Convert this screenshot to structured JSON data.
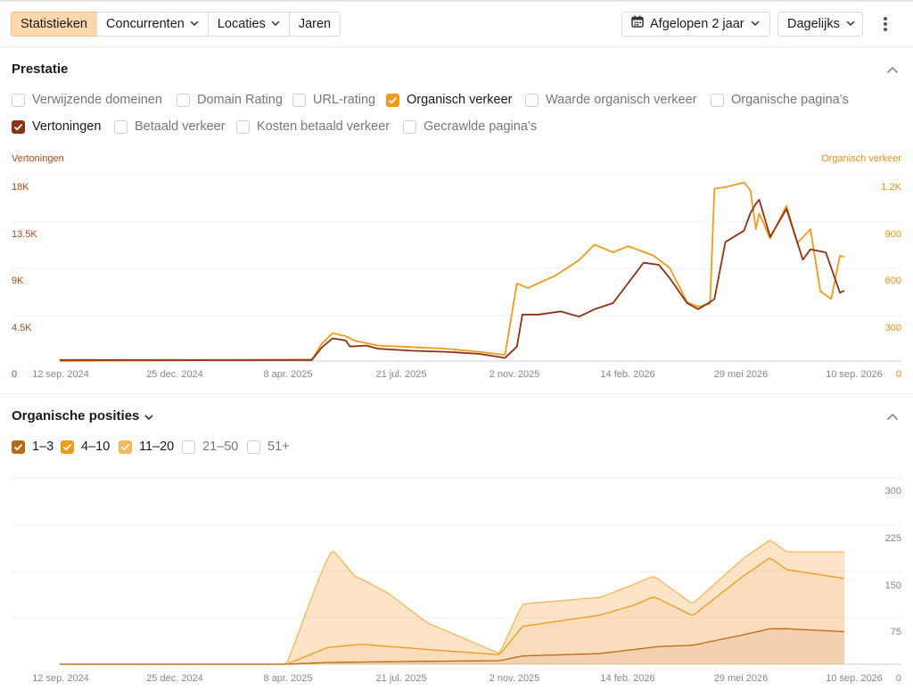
{
  "toolbar": {
    "tabs": [
      {
        "label": "Statistieken",
        "active": true,
        "dropdown": false
      },
      {
        "label": "Concurrenten",
        "active": false,
        "dropdown": true
      },
      {
        "label": "Locaties",
        "active": false,
        "dropdown": true
      },
      {
        "label": "Jaren",
        "active": false,
        "dropdown": false
      }
    ],
    "period_label": "Afgelopen 2 jaar",
    "period_icon": "calendar-icon",
    "granularity_label": "Dagelijks",
    "more_icon": "kebab-menu-icon"
  },
  "colors": {
    "brand_active_tab": "#fbd7ae",
    "organic_traffic": "#f29a1a",
    "impressions": "#8c3214",
    "pos_1_3": "#b86a12",
    "pos_4_10": "#f29a1a",
    "pos_11_20": "#f6b65c"
  },
  "performance": {
    "title": "Prestatie",
    "metrics": [
      {
        "label": "Verwijzende domeinen",
        "checked": false
      },
      {
        "label": "Domain Rating",
        "checked": false
      },
      {
        "label": "URL-rating",
        "checked": false
      },
      {
        "label": "Organisch verkeer",
        "checked": true,
        "color": "#f29a1a"
      },
      {
        "label": "Waarde organisch verkeer",
        "checked": false
      },
      {
        "label": "Organische pagina’s",
        "checked": false
      },
      {
        "label": "Vertoningen",
        "checked": true,
        "color": "#8c3214"
      },
      {
        "label": "Betaald verkeer",
        "checked": false
      },
      {
        "label": "Kosten betaald verkeer",
        "checked": false
      },
      {
        "label": "Gecrawlde pagina’s",
        "checked": false
      }
    ]
  },
  "positions": {
    "title": "Organische posities",
    "buckets": [
      {
        "label": "1–3",
        "checked": true,
        "color": "#b86a12"
      },
      {
        "label": "4–10",
        "checked": true,
        "color": "#f29a1a"
      },
      {
        "label": "11–20",
        "checked": true,
        "color": "#f6b65c"
      },
      {
        "label": "21–50",
        "checked": false
      },
      {
        "label": "51+",
        "checked": false
      }
    ]
  },
  "x_ticks": [
    "12 sep. 2024",
    "25 dec. 2024",
    "8 apr. 2025",
    "21 jul. 2025",
    "2 nov. 2025",
    "14 feb. 2026",
    "29 mei 2026",
    "10 sep. 2026"
  ],
  "chart_data": [
    {
      "type": "line",
      "left_axis_title": "Vertoningen",
      "right_axis_title": "Organisch verkeer",
      "left_ticks": [
        "18K",
        "13.5K",
        "9K",
        "4.5K",
        "0"
      ],
      "right_ticks": [
        "1.2K",
        "900",
        "600",
        "300",
        "0"
      ],
      "left_ylim": [
        0,
        18000
      ],
      "right_ylim": [
        0,
        1200
      ],
      "x_range": [
        "2024-09-12",
        "2026-09-10"
      ],
      "series": [
        {
          "name": "Vertoningen",
          "axis": "left",
          "x": [
            "2024-09-12",
            "2025-05-01",
            "2025-05-10",
            "2025-05-20",
            "2025-06-01",
            "2025-06-05",
            "2025-06-20",
            "2025-07-01",
            "2025-08-01",
            "2025-09-01",
            "2025-10-01",
            "2025-10-20",
            "2025-10-25",
            "2025-11-05",
            "2025-11-10",
            "2025-11-25",
            "2025-12-15",
            "2026-01-01",
            "2026-01-15",
            "2026-02-01",
            "2026-03-01",
            "2026-03-15",
            "2026-03-25",
            "2026-04-10",
            "2026-04-20",
            "2026-05-01",
            "2026-05-05",
            "2026-05-15",
            "2026-06-01",
            "2026-06-07",
            "2026-06-12",
            "2026-06-15",
            "2026-06-25",
            "2026-07-10",
            "2026-07-25",
            "2026-08-01",
            "2026-08-15",
            "2026-08-28",
            "2026-09-01"
          ],
          "y": [
            100,
            100,
            1300,
            2200,
            2000,
            1400,
            1500,
            1200,
            1000,
            900,
            700,
            400,
            300,
            1400,
            4500,
            4500,
            4800,
            4300,
            5000,
            5600,
            9500,
            9300,
            8000,
            5600,
            5000,
            5700,
            6000,
            11500,
            12600,
            14300,
            15200,
            15600,
            12000,
            14700,
            9800,
            10800,
            10500,
            6600,
            6800
          ]
        },
        {
          "name": "Organisch verkeer",
          "axis": "right",
          "x": [
            "2024-09-12",
            "2025-05-01",
            "2025-05-10",
            "2025-05-20",
            "2025-06-01",
            "2025-06-10",
            "2025-07-01",
            "2025-08-01",
            "2025-09-01",
            "2025-10-01",
            "2025-10-25",
            "2025-11-05",
            "2025-11-15",
            "2025-12-10",
            "2026-01-01",
            "2026-01-15",
            "2026-02-01",
            "2026-02-15",
            "2026-03-10",
            "2026-03-25",
            "2026-04-10",
            "2026-04-20",
            "2026-05-01",
            "2026-05-05",
            "2026-05-15",
            "2026-06-01",
            "2026-06-07",
            "2026-06-12",
            "2026-06-15",
            "2026-06-25",
            "2026-07-10",
            "2026-07-20",
            "2026-08-01",
            "2026-08-10",
            "2026-08-20",
            "2026-08-28",
            "2026-09-01"
          ],
          "y": [
            0,
            10,
            110,
            180,
            160,
            130,
            100,
            90,
            80,
            60,
            40,
            500,
            470,
            550,
            650,
            750,
            700,
            740,
            680,
            600,
            380,
            350,
            370,
            1110,
            1120,
            1150,
            1100,
            850,
            950,
            790,
            1000,
            760,
            850,
            450,
            400,
            680,
            670
          ]
        }
      ]
    },
    {
      "type": "area",
      "stacked": true,
      "right_ticks": [
        "300",
        "225",
        "150",
        "75",
        "0"
      ],
      "ylim": [
        0,
        300
      ],
      "x_range": [
        "2024-09-12",
        "2026-09-10"
      ],
      "series": [
        {
          "name": "1–3",
          "x": [
            "2024-09-12",
            "2025-04-08",
            "2025-05-15",
            "2025-08-15",
            "2025-10-20",
            "2025-11-10",
            "2026-01-20",
            "2026-03-15",
            "2026-04-15",
            "2026-06-01",
            "2026-06-25",
            "2026-07-10",
            "2026-09-01"
          ],
          "y": [
            0,
            0,
            3,
            5,
            6,
            14,
            18,
            30,
            32,
            50,
            60,
            60,
            55
          ]
        },
        {
          "name": "4–10",
          "x": [
            "2024-09-12",
            "2025-04-08",
            "2025-05-15",
            "2025-06-15",
            "2025-08-15",
            "2025-10-20",
            "2025-11-10",
            "2026-01-20",
            "2026-02-20",
            "2026-03-10",
            "2026-04-15",
            "2026-06-01",
            "2026-06-25",
            "2026-07-10",
            "2026-09-01"
          ],
          "y": [
            0,
            0,
            25,
            30,
            20,
            10,
            50,
            65,
            75,
            85,
            50,
            100,
            120,
            100,
            90
          ]
        },
        {
          "name": "11–20",
          "x": [
            "2024-09-12",
            "2025-04-08",
            "2025-05-08",
            "2025-05-20",
            "2025-06-10",
            "2025-07-10",
            "2025-08-15",
            "2025-10-20",
            "2025-11-10",
            "2026-01-20",
            "2026-02-20",
            "2026-03-10",
            "2026-04-15",
            "2026-06-01",
            "2026-06-25",
            "2026-07-10",
            "2026-09-01"
          ],
          "y": [
            0,
            0,
            125,
            165,
            115,
            90,
            45,
            2,
            38,
            30,
            35,
            35,
            20,
            30,
            30,
            30,
            45
          ]
        }
      ]
    }
  ]
}
